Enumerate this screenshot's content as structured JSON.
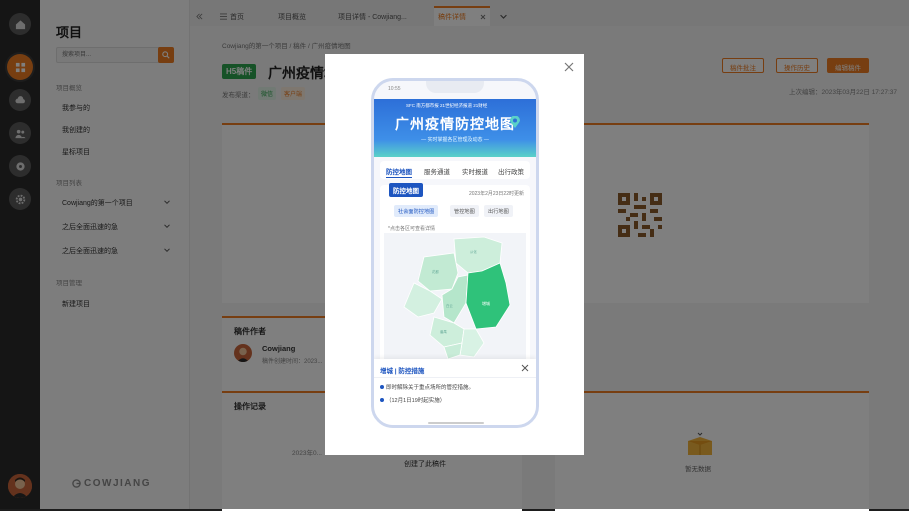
{
  "sidebar": {
    "title": "项目",
    "search_placeholder": "搜索项目...",
    "sections": [
      {
        "label": "项目概览",
        "items": [
          "我参与的",
          "我创建的",
          "星标项目"
        ]
      },
      {
        "label": "项目列表",
        "items": [
          "Cowjiang的第一个项目",
          "之后全面迅速的急",
          "之后全面迅速的急"
        ]
      },
      {
        "label": "项目管理",
        "items": [
          "新建项目"
        ]
      }
    ],
    "logo": "COWJIANG"
  },
  "tabs": [
    "首页",
    "项目概览",
    "项目详情 - Cowjiang...",
    "稿件详情"
  ],
  "breadcrumb": "Cowjiang的第一个项目  /  稿件  /  广州疫情地图",
  "manuscript": {
    "tag": "H5稿件",
    "title": "广州疫情地图",
    "publish_label": "发布渠道：",
    "channels": [
      "微信",
      "客户端"
    ],
    "actions": [
      "稿件批注",
      "操作历史",
      "编辑稿件"
    ],
    "last_edit": "上次编辑：2023年03月22日 17:27:37"
  },
  "author_card": {
    "title": "稿件作者",
    "name": "Cowjiang",
    "meta": "稿件创建时间：2023..."
  },
  "log_card": {
    "title": "操作记录",
    "time": "2023年0...",
    "entry": "创建了此稿件"
  },
  "right_card": {
    "title": "记录",
    "empty": "暂无数据"
  },
  "modal": {
    "phone": {
      "status_time": "10:55",
      "logos": "SFC 南方都市报 21世纪经济报道 21财经",
      "title": "广州疫情防控地图",
      "subtitle": "— 实时掌握各区管理及动态 —",
      "nav": [
        "防控地图",
        "服务通道",
        "实时报道",
        "出行政策"
      ],
      "card_badge": "防控地图",
      "card_date": "2023年2月23日22时更新",
      "subtabs": [
        "社会面防控地图",
        "管控地图",
        "出行地图"
      ],
      "hint": "*点击各区可查看详情",
      "districts": [
        "从化",
        "花都",
        "白云",
        "增城",
        "黄埔",
        "天河",
        "越秀",
        "海珠",
        "番禺",
        "南沙",
        "荔湾"
      ],
      "popup_title": "增城  |  防控措施",
      "popup_lines": [
        "即时解除关于重点场所的管控措施。",
        "（12月1日19时起实施）"
      ]
    }
  },
  "colors": {
    "accent": "#ee7d23",
    "hs_green": "#2da44e",
    "map_green": "#2fc27a",
    "map_light": "#bfe9d2",
    "phone_blue": "#1d55c0"
  }
}
